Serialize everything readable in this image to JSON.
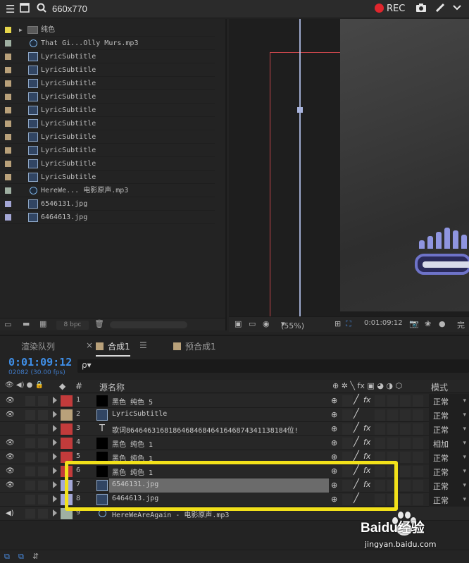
{
  "topbar": {
    "title": "660x770",
    "rec_label": "REC"
  },
  "project": {
    "items": [
      {
        "name": "纯色",
        "kind": "folder",
        "color": "#e6d64b"
      },
      {
        "name": "That Gi...Olly Murs.mp3",
        "kind": "audio",
        "color": "#9fb0a2"
      },
      {
        "name": "LyricSubtitle",
        "kind": "comp",
        "color": "#b9a17a"
      },
      {
        "name": "LyricSubtitle",
        "kind": "comp",
        "color": "#b9a17a"
      },
      {
        "name": "LyricSubtitle",
        "kind": "comp",
        "color": "#b9a17a"
      },
      {
        "name": "LyricSubtitle",
        "kind": "comp",
        "color": "#b9a17a"
      },
      {
        "name": "LyricSubtitle",
        "kind": "comp",
        "color": "#b9a17a"
      },
      {
        "name": "LyricSubtitle",
        "kind": "comp",
        "color": "#b9a17a"
      },
      {
        "name": "LyricSubtitle",
        "kind": "comp",
        "color": "#b9a17a"
      },
      {
        "name": "LyricSubtitle",
        "kind": "comp",
        "color": "#b9a17a"
      },
      {
        "name": "LyricSubtitle",
        "kind": "comp",
        "color": "#b9a17a"
      },
      {
        "name": "LyricSubtitle",
        "kind": "comp",
        "color": "#b9a17a"
      },
      {
        "name": "HereWe... 电影原声.mp3",
        "kind": "audio",
        "color": "#9fb0a2"
      },
      {
        "name": "6546131.jpg",
        "kind": "image",
        "color": "#a4a7d6"
      },
      {
        "name": "6464613.jpg",
        "kind": "image",
        "color": "#a4a7d6"
      }
    ],
    "bpc_label": "8 bpc"
  },
  "viewer": {
    "zoom": "(55%)",
    "timecode": "0:01:09:12",
    "last_label": "完"
  },
  "tabs": [
    {
      "label": "渲染队列",
      "active": false,
      "chip": ""
    },
    {
      "label": "合成1",
      "active": true,
      "chip": "#b9a17a"
    },
    {
      "label": "预合成1",
      "active": false,
      "chip": "#b9a17a"
    }
  ],
  "timeline": {
    "timecode": "0:01:09:12",
    "fps": "02082 (30.00 fps)",
    "search_placeholder": "ρ▾",
    "col_num": "#",
    "col_source": "源名称",
    "col_mode": "模式",
    "layers": [
      {
        "num": "1",
        "name": "黑色 纯色 5",
        "label": "#c23b3b",
        "src": "solid",
        "eye": true,
        "fx": true,
        "mode": "正常"
      },
      {
        "num": "2",
        "name": "LyricSubtitle",
        "label": "#b9a17a",
        "src": "comp",
        "eye": true,
        "fx": false,
        "mode": "正常"
      },
      {
        "num": "3",
        "name": "歌词8646463168186468468464164687434113818​4位!",
        "label": "#c23b3b",
        "src": "text",
        "eye": false,
        "fx": true,
        "mode": "正常"
      },
      {
        "num": "4",
        "name": "黑色 纯色 1",
        "label": "#c23b3b",
        "src": "solid",
        "eye": true,
        "fx": true,
        "mode": "相加"
      },
      {
        "num": "5",
        "name": "黑色 纯色 1",
        "label": "#c23b3b",
        "src": "solid",
        "eye": true,
        "fx": true,
        "mode": "正常"
      },
      {
        "num": "6",
        "name": "黑色 纯色 1",
        "label": "#c23b3b",
        "src": "solid",
        "eye": true,
        "fx": true,
        "mode": "正常"
      },
      {
        "num": "7",
        "name": "6546131.jpg",
        "label": "#a4a7d6",
        "src": "image",
        "eye": true,
        "fx": true,
        "mode": "正常",
        "selected": true
      },
      {
        "num": "8",
        "name": "6464613.jpg",
        "label": "#a4a7d6",
        "src": "image",
        "eye": false,
        "fx": false,
        "mode": "正常"
      },
      {
        "num": "9",
        "name": "HereWeAreAgain - 电影原声.mp3",
        "label": "#9fb0a2",
        "src": "audio",
        "eye": false,
        "fx": false,
        "mode": ""
      }
    ]
  },
  "watermark": {
    "brand": "Baidu经验",
    "url": "jingyan.baidu.com"
  },
  "colors": {
    "accent": "#3f8fe8",
    "highlight": "#f2e11a",
    "rec": "#e0262d"
  }
}
